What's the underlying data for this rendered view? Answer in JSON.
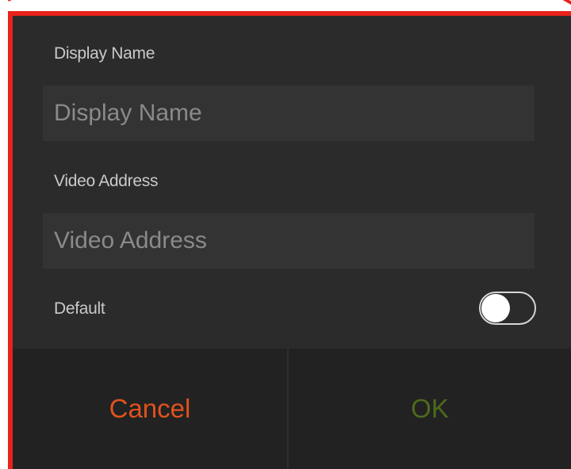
{
  "dialog": {
    "display_name": {
      "label": "Display Name",
      "placeholder": "Display Name",
      "value": ""
    },
    "video_address": {
      "label": "Video Address",
      "placeholder": "Video Address",
      "value": ""
    },
    "default": {
      "label": "Default",
      "checked": false
    },
    "buttons": {
      "cancel_label": "Cancel",
      "ok_label": "OK"
    }
  },
  "colors": {
    "highlight_outline": "#e8221b",
    "dialog_background": "#2b2b2b",
    "input_background": "#333333",
    "button_bar_background": "#222222",
    "cancel_text": "#e0521d",
    "ok_text": "#4e6a1c",
    "label_text": "#c9c9c9",
    "placeholder_text": "#8a8a8a"
  }
}
